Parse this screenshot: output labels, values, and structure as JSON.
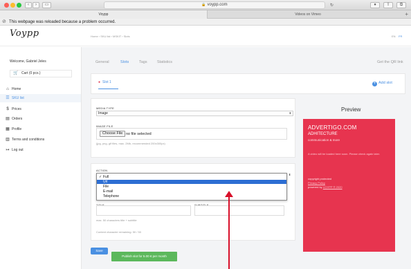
{
  "browser": {
    "url": "voypp.com",
    "tabs": [
      {
        "label": "Voypp",
        "active": true
      },
      {
        "label": "Videos on Vimeo",
        "active": false
      }
    ],
    "notice": "This webpage was reloaded because a problem occurred.",
    "back": "‹",
    "forward": "›",
    "new_tab": "+"
  },
  "header": {
    "logo": "Voypp",
    "breadcrumb": "Home  ›  SKU list  ›  MSKIT  ›  Slots",
    "lang_en": "EN",
    "lang_fr": "FR"
  },
  "sidebar": {
    "welcome": "Welcome, Gabriel Jeles",
    "cart": "Cart (0 pcs.)",
    "items": [
      {
        "label": "Home",
        "icon": "home-icon",
        "glyph": "⌂"
      },
      {
        "label": "SKU list",
        "icon": "list-icon",
        "glyph": "☰",
        "active": true
      },
      {
        "label": "Prices",
        "icon": "dollar-icon",
        "glyph": "$"
      },
      {
        "label": "Orders",
        "icon": "document-icon",
        "glyph": "▤"
      },
      {
        "label": "Profile",
        "icon": "id-card-icon",
        "glyph": "▦"
      },
      {
        "label": "Terms and conditions",
        "icon": "book-icon",
        "glyph": "▥"
      },
      {
        "label": "Log out",
        "icon": "logout-icon",
        "glyph": "↦"
      }
    ]
  },
  "tabs": [
    {
      "label": "General",
      "active": false
    },
    {
      "label": "Slots",
      "active": true
    },
    {
      "label": "Tags",
      "active": false
    },
    {
      "label": "Statistics",
      "active": false
    }
  ],
  "qr_link": "Get the QR link",
  "slots": {
    "current": "Slot 1",
    "add_label": "Add slot"
  },
  "media": {
    "type_label": "MEDIA TYPE",
    "type_value": "Image",
    "file_label": "IMAGE FILE",
    "choose_button": "Choose File",
    "file_status": "no file selected",
    "hint": "(jpg, png, gif files, max. 2Mb, recommended 200x300px)"
  },
  "action": {
    "label": "ACTION",
    "value": "Full",
    "options": [
      "Full",
      "Url",
      "File",
      "E-mail",
      "Telephone"
    ],
    "highlighted": "Url"
  },
  "texts": {
    "title_label": "TITLE",
    "subtitle_label": "SUBTITLE",
    "max_note": "max. 50 characters title + subtitle",
    "remaining": "Content character remaining: 50 / 50"
  },
  "buttons": {
    "save": "Save",
    "publish": "Publish slot for 5.00 € per month"
  },
  "preview": {
    "heading": "Preview",
    "brand": "ADVERTIGO.COM",
    "sub": "ADHITECTURE",
    "tagline": "communication & more",
    "note": "A video will be loaded here soon. Please check again later.",
    "copyright": "copyright protected",
    "link": "Privacy Policy",
    "powered_prefix": "powered by ",
    "powered_link": "VOYPP ® 2020"
  },
  "colors": {
    "accent": "#4a90e2",
    "preview_bg": "#e7344f",
    "publish": "#5cb85c",
    "annotation_arrow": "#d8102a"
  }
}
